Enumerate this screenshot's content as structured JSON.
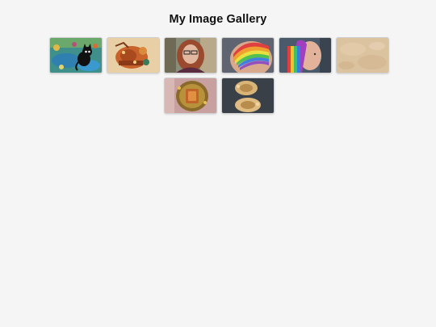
{
  "gallery": {
    "title": "My Image Gallery",
    "images": [
      {
        "subject": "cartoon black cat in a colorful pond landscape"
      },
      {
        "subject": "ornate orange decorated artwork"
      },
      {
        "subject": "person with glasses and reddish hair"
      },
      {
        "subject": "shaved head with rainbow dyed hair"
      },
      {
        "subject": "side profile with rainbow hair and facial piercings"
      },
      {
        "subject": "tan sand texture"
      },
      {
        "subject": "ornate gold brooch with amber gemstone held in hand"
      },
      {
        "subject": "ornate gold filigree pieces on dark background"
      }
    ]
  }
}
